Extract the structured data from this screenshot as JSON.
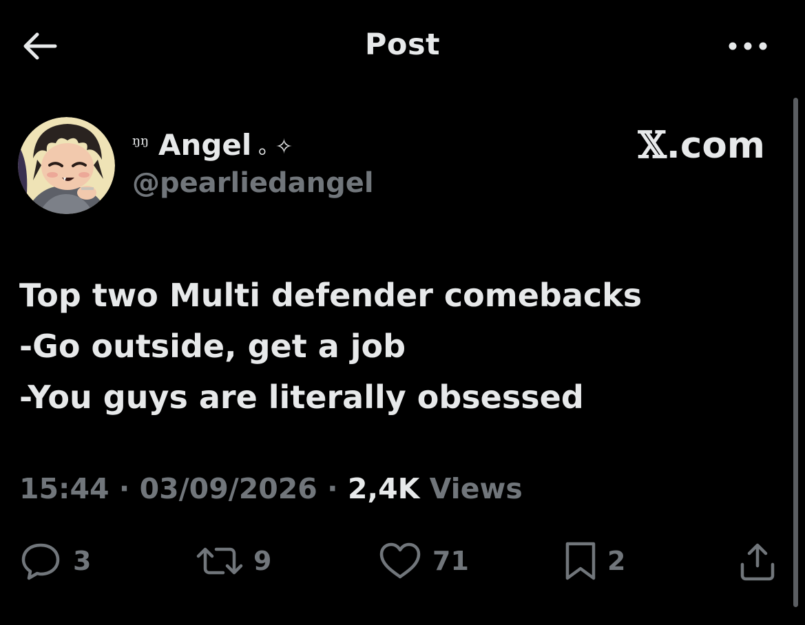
{
  "header": {
    "title": "Post",
    "back_icon": "arrow-left-icon",
    "more_icon": "more-dots-icon"
  },
  "author": {
    "name_prefix_glyph": "ᵑᵑ",
    "display_name": "Angel",
    "name_suffix": "｡ ✧",
    "handle": "@pearliedangel",
    "avatar_icon": "anime-avatar-icon"
  },
  "watermark": {
    "brand_x": "𝕏",
    "brand_rest": ".com"
  },
  "tweet": {
    "lines": [
      "Top two Multi defender comebacks",
      "-Go outside, get a job",
      "-You guys are literally obsessed"
    ]
  },
  "meta": {
    "time": "15:44",
    "separator": "·",
    "date": "03/09/2026",
    "views_count": "2,4K",
    "views_label": "Views"
  },
  "actions": {
    "replies": "3",
    "reposts": "9",
    "likes": "71",
    "bookmarks": "2"
  },
  "colors": {
    "background": "#000000",
    "text_primary": "#e7e9ea",
    "text_secondary": "#71767b"
  }
}
